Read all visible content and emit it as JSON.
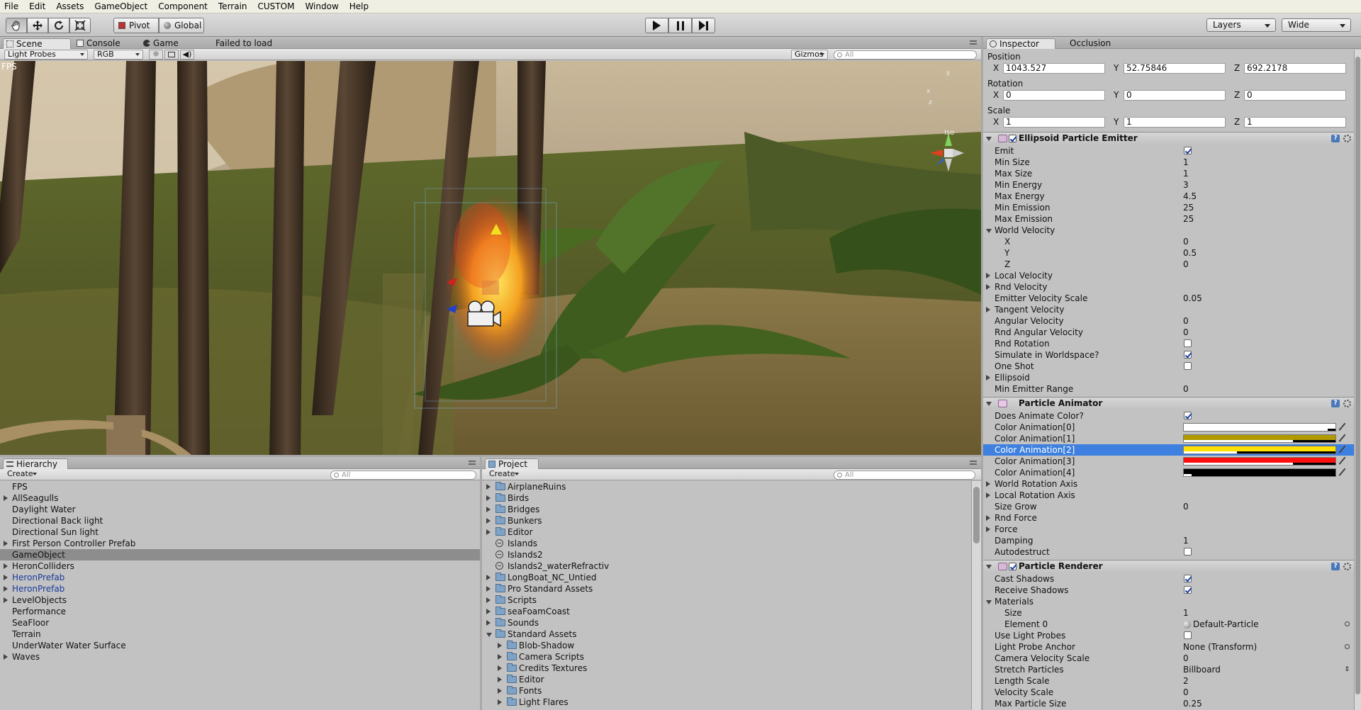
{
  "menu": [
    "File",
    "Edit",
    "Assets",
    "GameObject",
    "Component",
    "Terrain",
    "CUSTOM",
    "Window",
    "Help"
  ],
  "toolbar": {
    "pivot": "Pivot",
    "global": "Global",
    "layers": "Layers",
    "layout": "Wide"
  },
  "scene_panel": {
    "tabs": [
      "Scene",
      "Console",
      "Game"
    ],
    "status": "Failed to load",
    "render_mode": "Light Probes",
    "color_mode": "RGB",
    "gizmos": "Gizmos",
    "search_placeholder": "All",
    "fps_label": "FPS",
    "iso_label": "Iso",
    "axis_x": "x",
    "axis_y": "y",
    "axis_z": "z"
  },
  "hierarchy": {
    "tab": "Hierarchy",
    "create": "Create",
    "search_placeholder": "All",
    "items": [
      {
        "label": "FPS",
        "arrow": false
      },
      {
        "label": "AllSeagulls",
        "arrow": true
      },
      {
        "label": "Daylight Water",
        "arrow": false
      },
      {
        "label": "Directional Back light",
        "arrow": false
      },
      {
        "label": "Directional Sun light",
        "arrow": false
      },
      {
        "label": "First Person Controller Prefab",
        "arrow": true
      },
      {
        "label": "GameObject",
        "arrow": false,
        "selected": true
      },
      {
        "label": "HeronColliders",
        "arrow": true
      },
      {
        "label": "HeronPrefab",
        "arrow": true,
        "prefab": true
      },
      {
        "label": "HeronPrefab",
        "arrow": true,
        "prefab": true
      },
      {
        "label": "LevelObjects",
        "arrow": true
      },
      {
        "label": "Performance",
        "arrow": false
      },
      {
        "label": "SeaFloor",
        "arrow": false
      },
      {
        "label": "Terrain",
        "arrow": false
      },
      {
        "label": "UnderWater Water Surface",
        "arrow": false
      },
      {
        "label": "Waves",
        "arrow": true
      }
    ]
  },
  "project": {
    "tab": "Project",
    "create": "Create",
    "search_placeholder": "All",
    "items": [
      {
        "label": "AirplaneRuins",
        "type": "folder",
        "depth": 0,
        "arrow": "right"
      },
      {
        "label": "Birds",
        "type": "folder",
        "depth": 0,
        "arrow": "right"
      },
      {
        "label": "Bridges",
        "type": "folder",
        "depth": 0,
        "arrow": "right"
      },
      {
        "label": "Bunkers",
        "type": "folder",
        "depth": 0,
        "arrow": "right"
      },
      {
        "label": "Editor",
        "type": "folder",
        "depth": 0,
        "arrow": "right"
      },
      {
        "label": "Islands",
        "type": "scene",
        "depth": 0,
        "arrow": "none"
      },
      {
        "label": "Islands2",
        "type": "scene",
        "depth": 0,
        "arrow": "none"
      },
      {
        "label": "Islands2_waterRefractiv",
        "type": "scene",
        "depth": 0,
        "arrow": "none"
      },
      {
        "label": "LongBoat_NC_Untied",
        "type": "folder",
        "depth": 0,
        "arrow": "right"
      },
      {
        "label": "Pro Standard Assets",
        "type": "folder",
        "depth": 0,
        "arrow": "right"
      },
      {
        "label": "Scripts",
        "type": "folder",
        "depth": 0,
        "arrow": "right"
      },
      {
        "label": "seaFoamCoast",
        "type": "folder",
        "depth": 0,
        "arrow": "right"
      },
      {
        "label": "Sounds",
        "type": "folder",
        "depth": 0,
        "arrow": "right"
      },
      {
        "label": "Standard Assets",
        "type": "folder",
        "depth": 0,
        "arrow": "down"
      },
      {
        "label": "Blob-Shadow",
        "type": "folder",
        "depth": 1,
        "arrow": "right"
      },
      {
        "label": "Camera Scripts",
        "type": "folder",
        "depth": 1,
        "arrow": "right"
      },
      {
        "label": "Credits Textures",
        "type": "folder",
        "depth": 1,
        "arrow": "right"
      },
      {
        "label": "Editor",
        "type": "folder",
        "depth": 1,
        "arrow": "right"
      },
      {
        "label": "Fonts",
        "type": "folder",
        "depth": 1,
        "arrow": "right"
      },
      {
        "label": "Light Flares",
        "type": "folder",
        "depth": 1,
        "arrow": "right"
      }
    ]
  },
  "inspector": {
    "tabs": [
      "Inspector",
      "Occlusion"
    ],
    "transform": {
      "position_label": "Position",
      "rotation_label": "Rotation",
      "scale_label": "Scale",
      "axis": [
        "X",
        "Y",
        "Z"
      ],
      "position": [
        "1043.527",
        "52.75846",
        "692.2178"
      ],
      "rotation": [
        "0",
        "0",
        "0"
      ],
      "scale": [
        "1",
        "1",
        "1"
      ]
    },
    "emitter": {
      "title": "Ellipsoid Particle Emitter",
      "rows": [
        {
          "label": "Emit",
          "kind": "check",
          "value": true
        },
        {
          "label": "Min Size",
          "kind": "text",
          "value": "1"
        },
        {
          "label": "Max Size",
          "kind": "text",
          "value": "1"
        },
        {
          "label": "Min Energy",
          "kind": "text",
          "value": "3"
        },
        {
          "label": "Max Energy",
          "kind": "text",
          "value": "4.5"
        },
        {
          "label": "Min Emission",
          "kind": "text",
          "value": "25"
        },
        {
          "label": "Max Emission",
          "kind": "text",
          "value": "25"
        },
        {
          "label": "World Velocity",
          "kind": "fold",
          "open": true
        },
        {
          "label": "X",
          "kind": "text",
          "value": "0",
          "indent": true
        },
        {
          "label": "Y",
          "kind": "text",
          "value": "0.5",
          "indent": true
        },
        {
          "label": "Z",
          "kind": "text",
          "value": "0",
          "indent": true
        },
        {
          "label": "Local Velocity",
          "kind": "fold",
          "open": false
        },
        {
          "label": "Rnd Velocity",
          "kind": "fold",
          "open": false
        },
        {
          "label": "Emitter Velocity Scale",
          "kind": "text",
          "value": "0.05"
        },
        {
          "label": "Tangent Velocity",
          "kind": "fold",
          "open": false
        },
        {
          "label": "Angular Velocity",
          "kind": "text",
          "value": "0"
        },
        {
          "label": "Rnd Angular Velocity",
          "kind": "text",
          "value": "0"
        },
        {
          "label": "Rnd Rotation",
          "kind": "check",
          "value": false
        },
        {
          "label": "Simulate in Worldspace?",
          "kind": "check",
          "value": true
        },
        {
          "label": "One Shot",
          "kind": "check",
          "value": false
        },
        {
          "label": "Ellipsoid",
          "kind": "fold",
          "open": false
        },
        {
          "label": "Min Emitter Range",
          "kind": "text",
          "value": "0"
        }
      ]
    },
    "animator": {
      "title": "Particle Animator",
      "rows": [
        {
          "label": "Does Animate Color?",
          "kind": "check",
          "value": true
        },
        {
          "label": "Color Animation[0]",
          "kind": "color",
          "color": "#ffffff",
          "alpha": 0.95
        },
        {
          "label": "Color Animation[1]",
          "kind": "color",
          "color": "#b09a00",
          "alpha": 0.72
        },
        {
          "label": "Color Animation[2]",
          "kind": "color",
          "color": "#ffe000",
          "alpha": 0.35,
          "selected": true
        },
        {
          "label": "Color Animation[3]",
          "kind": "color",
          "color": "#ff1010",
          "alpha": 0.72
        },
        {
          "label": "Color Animation[4]",
          "kind": "color",
          "color": "#000000",
          "alpha": 0.05
        },
        {
          "label": "World Rotation Axis",
          "kind": "fold",
          "open": false
        },
        {
          "label": "Local Rotation Axis",
          "kind": "fold",
          "open": false
        },
        {
          "label": "Size Grow",
          "kind": "text",
          "value": "0"
        },
        {
          "label": "Rnd Force",
          "kind": "fold",
          "open": false
        },
        {
          "label": "Force",
          "kind": "fold",
          "open": false
        },
        {
          "label": "Damping",
          "kind": "text",
          "value": "1"
        },
        {
          "label": "Autodestruct",
          "kind": "check",
          "value": false
        }
      ]
    },
    "renderer": {
      "title": "Particle Renderer",
      "rows": [
        {
          "label": "Cast Shadows",
          "kind": "check",
          "value": true
        },
        {
          "label": "Receive Shadows",
          "kind": "check",
          "value": true
        },
        {
          "label": "Materials",
          "kind": "fold",
          "open": true
        },
        {
          "label": "Size",
          "kind": "text",
          "value": "1",
          "indent": true
        },
        {
          "label": "Element 0",
          "kind": "object",
          "value": "Default-Particle",
          "indent": true
        },
        {
          "label": "Use Light Probes",
          "kind": "check",
          "value": false
        },
        {
          "label": "Light Probe Anchor",
          "kind": "object",
          "value": "None (Transform)",
          "nodot": true
        },
        {
          "label": "Camera Velocity Scale",
          "kind": "text",
          "value": "0"
        },
        {
          "label": "Stretch Particles",
          "kind": "enum",
          "value": "Billboard"
        },
        {
          "label": "Length Scale",
          "kind": "text",
          "value": "2"
        },
        {
          "label": "Velocity Scale",
          "kind": "text",
          "value": "0"
        },
        {
          "label": "Max Particle Size",
          "kind": "text",
          "value": "0.25"
        }
      ]
    }
  },
  "colors": {
    "selection": "#3d80df",
    "panel": "#c2c2c2",
    "prefab_text": "#1a3a9c"
  }
}
